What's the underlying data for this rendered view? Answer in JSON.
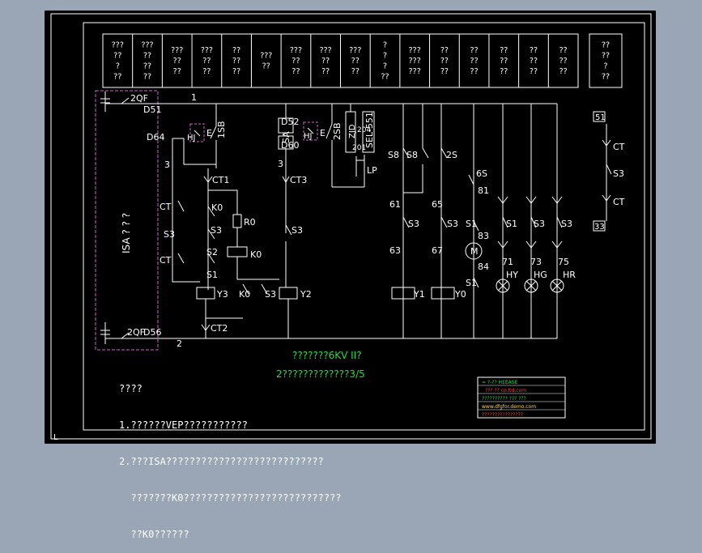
{
  "header_cells": [
    [
      "???",
      "??",
      "?",
      "??"
    ],
    [
      "???",
      "??",
      "??",
      "??"
    ],
    [
      "???",
      "??",
      "??"
    ],
    [
      "???",
      "??",
      "??"
    ],
    [
      "??",
      "??",
      "??"
    ],
    [
      "???",
      "??"
    ],
    [
      "???",
      "??",
      "??"
    ],
    [
      "???",
      "??",
      "??"
    ],
    [
      "???",
      "??",
      "??"
    ],
    [
      "?",
      "?",
      "?",
      "??"
    ],
    [
      "???",
      "???",
      "???"
    ],
    [
      "??",
      "??",
      "??"
    ],
    [
      "??",
      "??",
      "??"
    ],
    [
      "??",
      "??",
      "??"
    ],
    [
      "??",
      "??",
      "??"
    ],
    [
      "??",
      "??",
      "??"
    ],
    [
      "??",
      "??",
      "?",
      "??"
    ]
  ],
  "isa_label": "ISA  ? ? ?",
  "labels": {
    "n1": "1",
    "n2": "2",
    "n3a": "3",
    "n3b": "3",
    "qf_top": "2QF",
    "qf_bot": "2QF",
    "d51": "D51",
    "d56": "D56",
    "d64": "D64",
    "d52": "D52",
    "d60": "D60",
    "d56b": "56",
    "sa": "SA",
    "hj1": "HJ",
    "hj2": "HJ",
    "e1": "E",
    "e2": "E",
    "sb1": "1SB",
    "sb2": "2SB",
    "ct1": "CT1",
    "ct2": "CT2",
    "ct3": "CT3",
    "ct_a": "CT",
    "ct_b": "CT",
    "s3_a": "S3",
    "s3_b": "S3",
    "s3_c": "S3",
    "s2": "S2",
    "s1": "S1",
    "k0_a": "K0",
    "k0_b": "K0",
    "k0_c": "K0",
    "r0": "R0",
    "y3": "Y3",
    "y2": "Y2",
    "y1": "Y1",
    "y0": "Y0",
    "s3_d": "S3",
    "zjd": "ZJD",
    "sel": "SEL-551",
    "lp": "LP",
    "num201": "201",
    "num204": "204",
    "s8a": "S8",
    "s8b": "S8",
    "sw2s": "2S",
    "sw6s": "6S",
    "n61": "61",
    "n63": "63",
    "n65": "65",
    "n67": "67",
    "n81": "81",
    "n83": "83",
    "n84": "84",
    "n71": "71",
    "n73": "73",
    "n75": "75",
    "s3_e": "S3",
    "s3_f": "S3",
    "s3_g": "S3",
    "s3_h": "S3",
    "s1_b": "S1",
    "s1_c": "S1",
    "s1_d": "S1",
    "hy": "HY",
    "hg": "HG",
    "hr": "HR",
    "m": "M",
    "r51": "51",
    "r33": "33",
    "r_ct1": "CT",
    "r_ct2": "CT",
    "r_s3": "S3",
    "corner": "L"
  },
  "green_title": "???????6KV II?",
  "green_subtitle": "2?????????????3/5",
  "notes": [
    "????",
    "1.??????VEP???????????",
    "2.???ISA???????????????????????????",
    "  ???????K0???????????????????????????",
    "  ??K0??????"
  ],
  "title_block": {
    "row1": "= ?-?? HEEASE",
    "row2": "??? ?? co.ltd.com",
    "row3": "?????????? ??? ???",
    "row4": "www.dfgfor.demo.com",
    "row5": "????????????????"
  }
}
